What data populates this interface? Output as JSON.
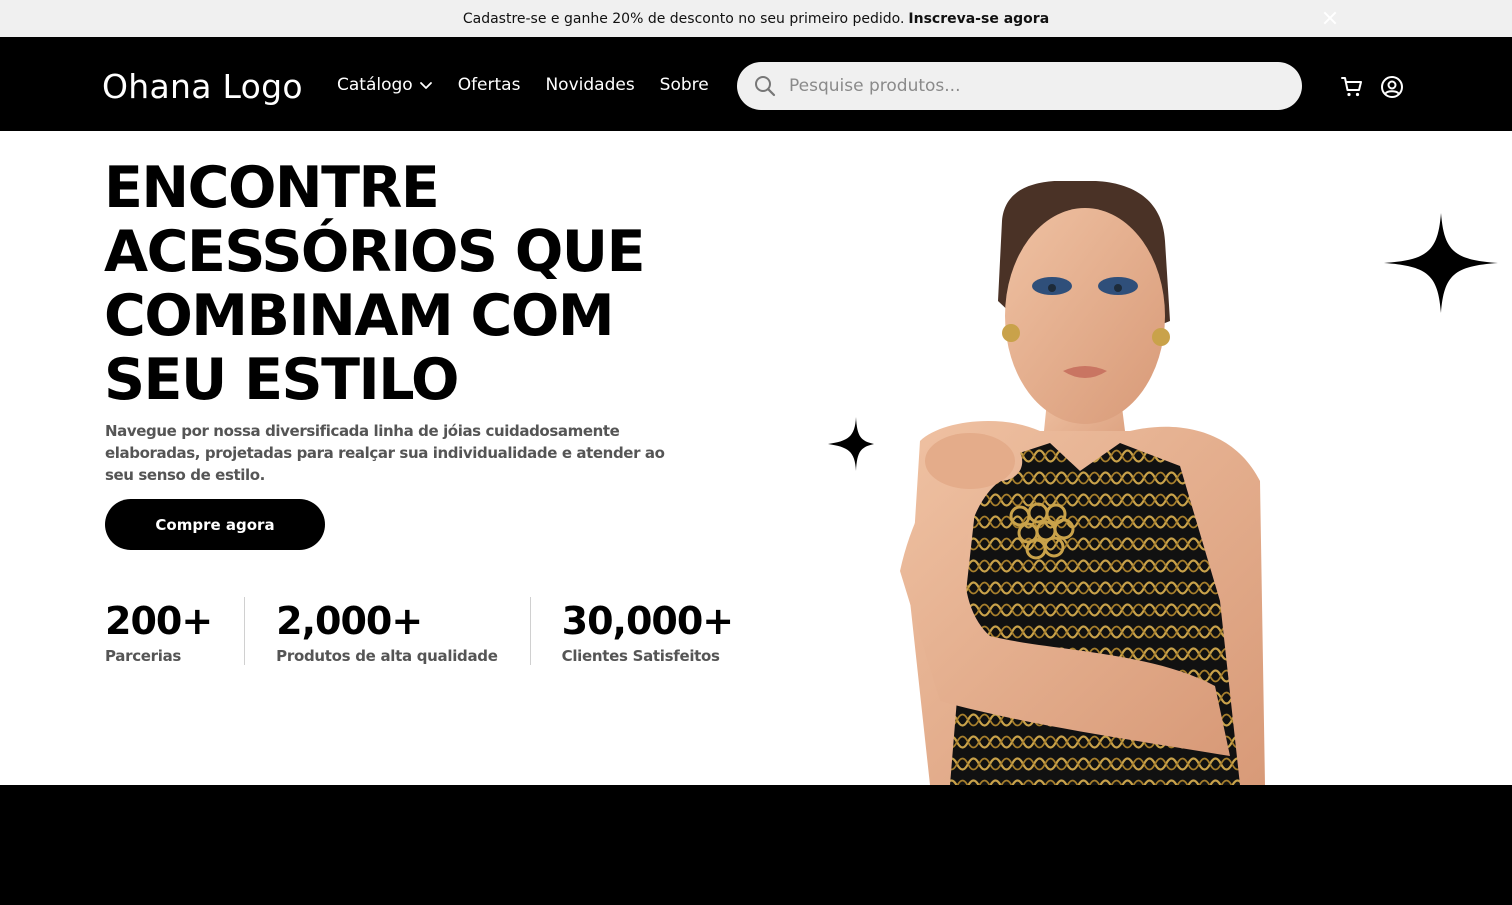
{
  "promo": {
    "text": "Cadastre-se e ganhe 20% de desconto no seu primeiro pedido.",
    "cta": "Inscreva-se agora"
  },
  "header": {
    "logo": "Ohana Logo",
    "nav": [
      {
        "label": "Catálogo",
        "has_dropdown": true
      },
      {
        "label": "Ofertas"
      },
      {
        "label": "Novidades"
      },
      {
        "label": "Sobre"
      }
    ],
    "search": {
      "placeholder": "Pesquise produtos..."
    },
    "icons": [
      "cart-icon",
      "user-icon"
    ]
  },
  "hero": {
    "headline_lines": [
      "ENCONTRE",
      "ACESSÓRIOS QUE",
      "COMBINAM COM",
      "SEU ESTILO"
    ],
    "description": "Navegue por nossa diversificada linha de jóias  cuidadosamente elaboradas, projetadas para realçar sua individualidade e atender ao seu senso de estilo.",
    "cta": "Compre agora",
    "stats": [
      {
        "value": "200+",
        "label": "Parcerias"
      },
      {
        "value": "2,000+",
        "label": "Produtos de alta qualidade"
      },
      {
        "value": "30,000+",
        "label": "Clientes Satisfeitos"
      }
    ]
  },
  "colors": {
    "primary": "#000000",
    "promo_bg": "#f0f0f0",
    "search_bg": "#f0f0f0",
    "muted_text": "#555555",
    "gold": "#c9a24a"
  }
}
